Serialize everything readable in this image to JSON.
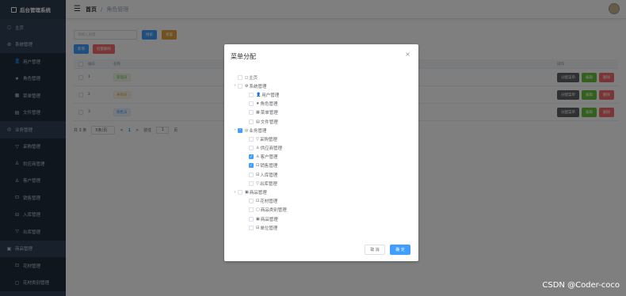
{
  "sidebar": {
    "logo": "后台管理系统",
    "items": [
      {
        "label": "主页",
        "icon": "○",
        "type": "top"
      },
      {
        "label": "系统管理",
        "icon": "⚙",
        "type": "group"
      },
      {
        "label": "用户管理",
        "icon": "👤",
        "type": "sub"
      },
      {
        "label": "角色管理",
        "icon": "★",
        "type": "sub"
      },
      {
        "label": "菜单管理",
        "icon": "▦",
        "type": "sub"
      },
      {
        "label": "文件管理",
        "icon": "▤",
        "type": "sub"
      },
      {
        "label": "业务管理",
        "icon": "◎",
        "type": "group"
      },
      {
        "label": "采购管理",
        "icon": "▽",
        "type": "sub"
      },
      {
        "label": "供应商管理",
        "icon": "♙",
        "type": "sub"
      },
      {
        "label": "客户管理",
        "icon": "♙",
        "type": "sub"
      },
      {
        "label": "销售管理",
        "icon": "⊡",
        "type": "sub"
      },
      {
        "label": "入库管理",
        "icon": "⊟",
        "type": "sub"
      },
      {
        "label": "出库管理",
        "icon": "▽",
        "type": "sub"
      },
      {
        "label": "商品管理",
        "icon": "▣",
        "type": "group"
      },
      {
        "label": "花材管理",
        "icon": "⊡",
        "type": "sub"
      },
      {
        "label": "花材类别管理",
        "icon": "▢",
        "type": "sub"
      }
    ]
  },
  "navbar": {
    "home": "首页",
    "sep": "/",
    "current": "角色管理"
  },
  "toolbar": {
    "search_placeholder": "请输入关键",
    "search_btn": "搜索",
    "reset_btn": "重置",
    "add_btn": "新增",
    "batch_delete_btn": "批量删除"
  },
  "table": {
    "headers": {
      "no": "编号",
      "name": "名称",
      "ops": "操作"
    },
    "rows": [
      {
        "no": "1",
        "name": "管理员",
        "tag": "green"
      },
      {
        "no": "2",
        "name": "采购员",
        "tag": "orange"
      },
      {
        "no": "3",
        "name": "销售员",
        "tag": "blue"
      }
    ],
    "ops": {
      "assign": "分配菜单",
      "edit": "编辑",
      "delete": "删除"
    }
  },
  "pager": {
    "total": "共 3 条",
    "size": "5条/页",
    "prev": "<",
    "page": "1",
    "next": ">",
    "goto": "前往",
    "jump": "1",
    "unit": "页"
  },
  "dialog": {
    "title": "菜单分配",
    "close": "×",
    "cancel": "取 消",
    "ok": "确 定",
    "tree": [
      {
        "label": "主页",
        "icon": "◻",
        "level": 0,
        "arrow": "",
        "state": "none"
      },
      {
        "label": "系统管理",
        "icon": "⚙",
        "level": 0,
        "arrow": "▾",
        "state": "none"
      },
      {
        "label": "用户管理",
        "icon": "👤",
        "level": 1,
        "arrow": "",
        "state": "none"
      },
      {
        "label": "角色管理",
        "icon": "★",
        "level": 1,
        "arrow": "",
        "state": "none"
      },
      {
        "label": "菜单管理",
        "icon": "▦",
        "level": 1,
        "arrow": "",
        "state": "none"
      },
      {
        "label": "文件管理",
        "icon": "▤",
        "level": 1,
        "arrow": "",
        "state": "none"
      },
      {
        "label": "业务管理",
        "icon": "◎",
        "level": 0,
        "arrow": "▾",
        "state": "half"
      },
      {
        "label": "采购管理",
        "icon": "▽",
        "level": 1,
        "arrow": "",
        "state": "none"
      },
      {
        "label": "供应商管理",
        "icon": "♙",
        "level": 1,
        "arrow": "",
        "state": "none"
      },
      {
        "label": "客户管理",
        "icon": "♙",
        "level": 1,
        "arrow": "",
        "state": "checked"
      },
      {
        "label": "销售管理",
        "icon": "⊡",
        "level": 1,
        "arrow": "",
        "state": "checked"
      },
      {
        "label": "入库管理",
        "icon": "⊟",
        "level": 1,
        "arrow": "",
        "state": "none"
      },
      {
        "label": "出库管理",
        "icon": "▽",
        "level": 1,
        "arrow": "",
        "state": "none"
      },
      {
        "label": "商品管理",
        "icon": "▣",
        "level": 0,
        "arrow": "▾",
        "state": "none"
      },
      {
        "label": "花材管理",
        "icon": "⊡",
        "level": 1,
        "arrow": "",
        "state": "none"
      },
      {
        "label": "商品类别管理",
        "icon": "▢",
        "level": 1,
        "arrow": "",
        "state": "none"
      },
      {
        "label": "商品管理",
        "icon": "▣",
        "level": 1,
        "arrow": "",
        "state": "none"
      },
      {
        "label": "单位管理",
        "icon": "⊟",
        "level": 1,
        "arrow": "",
        "state": "none"
      }
    ]
  },
  "watermark": "CSDN @Coder-coco",
  "colors": {
    "primary": "#409eff",
    "sidebar": "#304156"
  }
}
